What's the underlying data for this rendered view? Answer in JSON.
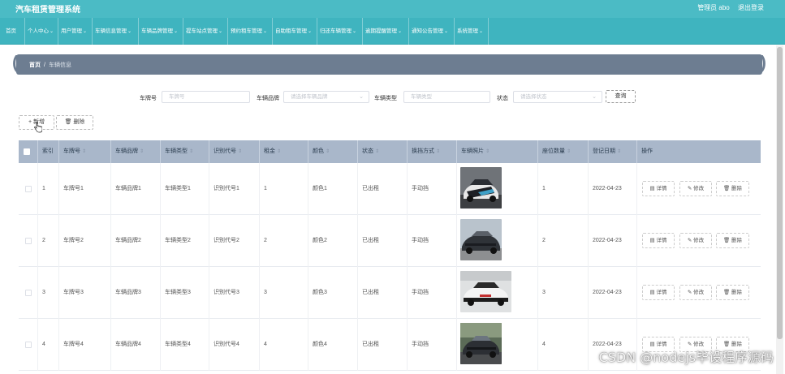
{
  "header": {
    "title": "汽车租赁管理系统",
    "user_label": "管理员 abo",
    "logout_label": "退出登录"
  },
  "nav": [
    {
      "label": "首页",
      "has_dropdown": false
    },
    {
      "label": "个人中心",
      "has_dropdown": true
    },
    {
      "label": "用户管理",
      "has_dropdown": true
    },
    {
      "label": "车辆信息管理",
      "has_dropdown": true
    },
    {
      "label": "车辆品牌管理",
      "has_dropdown": true
    },
    {
      "label": "提车站点管理",
      "has_dropdown": true
    },
    {
      "label": "预约租车管理",
      "has_dropdown": true
    },
    {
      "label": "自助租车管理",
      "has_dropdown": true
    },
    {
      "label": "归还车辆管理",
      "has_dropdown": true
    },
    {
      "label": "逾期提醒管理",
      "has_dropdown": true
    },
    {
      "label": "通知公告管理",
      "has_dropdown": true
    },
    {
      "label": "系统管理",
      "has_dropdown": true
    }
  ],
  "breadcrumb": {
    "home": "首页",
    "separator": "/",
    "current": "车辆信息"
  },
  "search": {
    "plate_label": "车牌号",
    "plate_placeholder": "车牌号",
    "brand_label": "车辆品牌",
    "brand_placeholder": "请选择车辆品牌",
    "type_label": "车辆类型",
    "type_placeholder": "车辆类型",
    "status_label": "状态",
    "status_placeholder": "请选择状态",
    "query_button": "查询"
  },
  "toolbar": {
    "add_label": "+ 新增",
    "delete_label": "删除"
  },
  "table": {
    "headers": [
      "索引",
      "车牌号",
      "车辆品牌",
      "车辆类型",
      "识别代号",
      "租金",
      "颜色",
      "状态",
      "换挡方式",
      "车辆照片",
      "座位数量",
      "登记日期",
      "操作"
    ],
    "rows": [
      {
        "index": "1",
        "plate": "车牌号1",
        "brand": "车辆品牌1",
        "type": "车辆类型1",
        "code": "识别代号1",
        "rent": "1",
        "color": "颜色1",
        "status": "已出租",
        "gear": "手动挡",
        "seats": "1",
        "date": "2022-04-23"
      },
      {
        "index": "2",
        "plate": "车牌号2",
        "brand": "车辆品牌2",
        "type": "车辆类型2",
        "code": "识别代号2",
        "rent": "2",
        "color": "颜色2",
        "status": "已出租",
        "gear": "手动挡",
        "seats": "2",
        "date": "2022-04-23"
      },
      {
        "index": "3",
        "plate": "车牌号3",
        "brand": "车辆品牌3",
        "type": "车辆类型3",
        "code": "识别代号3",
        "rent": "3",
        "color": "颜色3",
        "status": "已出租",
        "gear": "手动挡",
        "seats": "3",
        "date": "2022-04-23"
      },
      {
        "index": "4",
        "plate": "车牌号4",
        "brand": "车辆品牌4",
        "type": "车辆类型4",
        "code": "识别代号4",
        "rent": "4",
        "color": "颜色4",
        "status": "已出租",
        "gear": "手动挡",
        "seats": "4",
        "date": "2022-04-23"
      }
    ],
    "actions": {
      "detail": "详情",
      "edit": "修改",
      "delete": "删除"
    }
  },
  "watermark": "CSDN @nodejs毕设程序源码",
  "colors": {
    "header_bg": "#4bbbc5",
    "nav_bg": "#3fb4bf",
    "breadcrumb_bg": "#6d7d91",
    "table_header_bg": "#a9b7ca"
  }
}
